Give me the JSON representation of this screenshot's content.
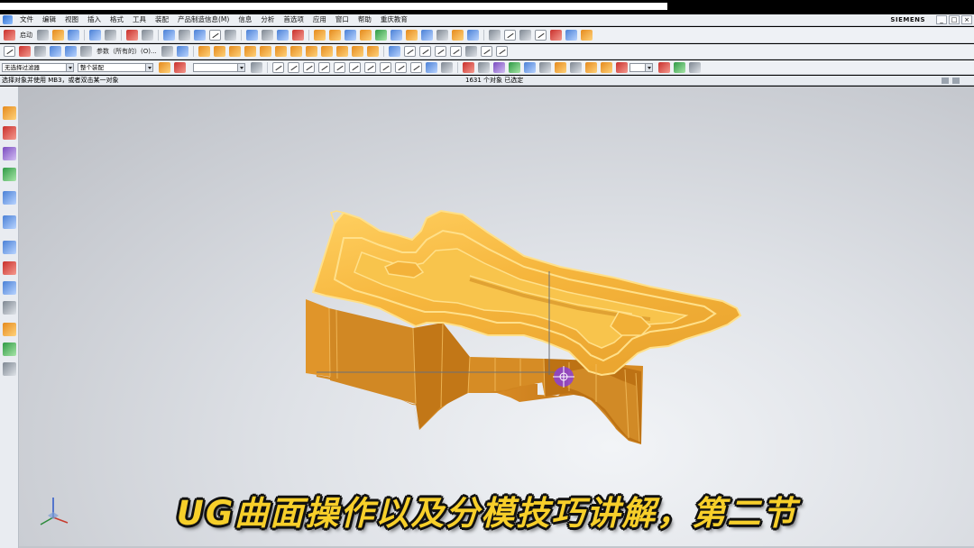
{
  "window": {
    "brand": "SIEMENS",
    "controls": [
      "_",
      "□",
      "×"
    ]
  },
  "menu": {
    "items": [
      "文件",
      "编辑",
      "视图",
      "插入",
      "格式",
      "工具",
      "装配",
      "产品制造信息(M)",
      "信息",
      "分析",
      "首选项",
      "应用",
      "窗口",
      "帮助",
      "重庆教育"
    ]
  },
  "toolbar": {
    "start_label": "启动",
    "reference_label": "参数（所有的）(O)...",
    "selection_filter": "无选择过滤器",
    "assembly_scope": "整个装配",
    "icons_row1": [
      "start-icon",
      "new-file-icon",
      "open-file-icon",
      "save-icon",
      "undo-icon",
      "redo-icon",
      "fit-view-icon",
      "zoom-icon",
      "rotate-icon",
      "shaded-view-icon",
      "wireframe-icon",
      "orient-view-icon",
      "layer-icon",
      "sketch-icon",
      "extrude-icon",
      "revolve-icon",
      "blend-icon",
      "chamfer-icon",
      "hole-icon",
      "boolean-icon",
      "shell-icon",
      "draft-icon",
      "pattern-icon",
      "mirror-icon",
      "offset-face-icon",
      "sew-icon",
      "trim-body-icon",
      "surface-icon",
      "curve-icon",
      "spline-icon",
      "sm-icon",
      "help-icon"
    ],
    "icons_row2": [
      "line-icon",
      "sketch-plane-icon",
      "datum-icon",
      "mesh-icon",
      "surface-grid-icon",
      "through-curves-icon",
      "parameter-icon",
      "face-icon",
      "region-icon",
      "extract-icon",
      "block-icon",
      "cylinder-icon",
      "cone-icon",
      "sphere-icon",
      "union-icon",
      "subtract-icon",
      "intersect-icon",
      "trim-icon",
      "split-icon",
      "patch-icon",
      "bridge-icon",
      "curve-on-surface-icon",
      "project-icon",
      "intersect-curve-icon",
      "section-curve-icon",
      "offset-curve-icon",
      "edit-curve-icon"
    ],
    "icons_row3": [
      "snap-icon",
      "select-icon",
      "box-icon",
      "line-point-icon",
      "arc-point-icon",
      "endpoint-icon",
      "midpoint-icon",
      "control-point-icon",
      "intersection-icon",
      "center-icon",
      "quadrant-icon",
      "existing-point-icon",
      "point-on-curve-icon",
      "point-on-face-icon",
      "grid-icon",
      "select-all-icon",
      "deselect-icon",
      "filter-icon",
      "feature-icon",
      "body-icon",
      "face-filter-icon",
      "edge-filter-icon",
      "component-icon",
      "color-icon",
      "display-icon"
    ]
  },
  "status": {
    "prompt": "选择对象并使用 MB3，或者双击某一对象",
    "selection_count": "1631 个对象 已选定"
  },
  "resource_bar": {
    "icons": [
      "assembly-navigator-icon",
      "constraint-navigator-icon",
      "part-navigator-icon",
      "reuse-library-icon",
      "hd3d-tools-icon",
      "web-browser-icon",
      "history-icon",
      "process-studio-icon",
      "roles-icon",
      "system-scenes-icon",
      "palette-icon",
      "ug-manager-icon",
      "layout-icon"
    ]
  },
  "colors": {
    "part_fill": "#f4b338",
    "part_top": "#f7c24a",
    "part_side": "#d9891f",
    "part_edge": "#ffe08a",
    "caption": "#f7cf2a",
    "cursor": "#8b3fd8"
  },
  "caption": "UG曲面操作以及分模技巧讲解，第二节"
}
